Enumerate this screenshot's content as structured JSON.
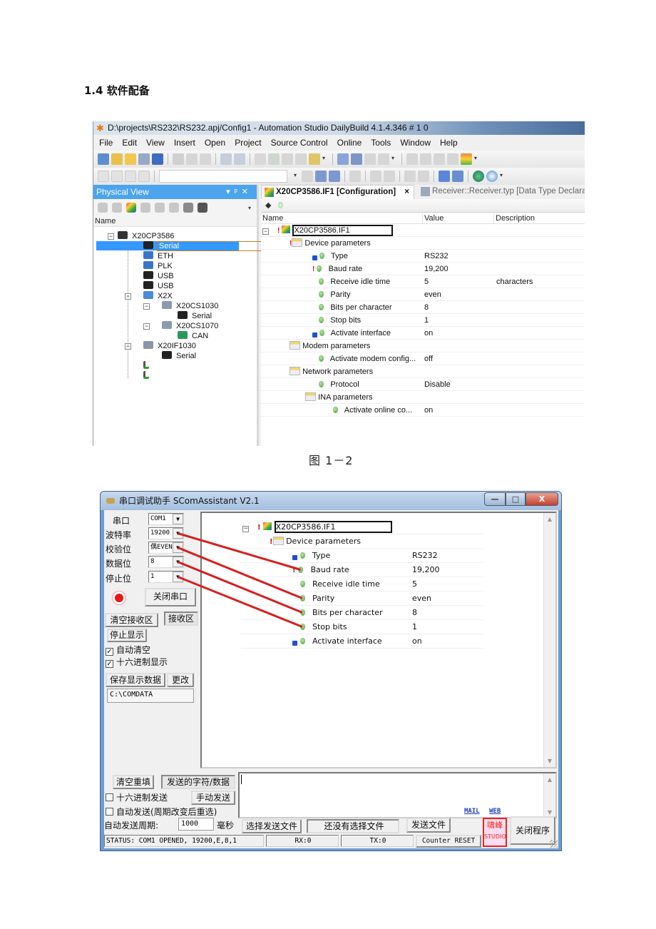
{
  "document": {
    "heading": "1.4 软件配备",
    "figure_caption": "图 1－2"
  },
  "automation_studio": {
    "title": "D:\\projects\\RS232\\RS232.apj/Config1 - Automation Studio DailyBuild 4.1.4.346 # 1 0",
    "menu": [
      "File",
      "Edit",
      "View",
      "Insert",
      "Open",
      "Project",
      "Source Control",
      "Online",
      "Tools",
      "Window",
      "Help"
    ],
    "physical_view": {
      "title": "Physical View",
      "column_header": "Name",
      "tree": [
        {
          "label": "X20CP3586",
          "icon": "cpu-icon",
          "level": 0
        },
        {
          "label": "Serial",
          "icon": "serial-port-icon",
          "level": 1,
          "selected": true
        },
        {
          "label": "ETH",
          "icon": "ethernet-icon",
          "level": 1
        },
        {
          "label": "PLK",
          "icon": "powerlink-icon",
          "level": 1
        },
        {
          "label": "USB",
          "icon": "usb-icon",
          "level": 1
        },
        {
          "label": "USB",
          "icon": "usb-icon",
          "level": 1
        },
        {
          "label": "X2X",
          "icon": "x2x-bus-icon",
          "level": 1
        },
        {
          "label": "X20CS1030",
          "icon": "module-icon",
          "level": 2
        },
        {
          "label": "Serial",
          "icon": "serial-port-icon",
          "level": 3
        },
        {
          "label": "X20CS1070",
          "icon": "module-icon",
          "level": 2
        },
        {
          "label": "CAN",
          "icon": "can-icon",
          "level": 3
        },
        {
          "label": "X20IF1030",
          "icon": "interface-module-icon",
          "level": 1
        },
        {
          "label": "Serial",
          "icon": "serial-port-icon",
          "level": 2
        },
        {
          "label": "",
          "icon": "add-slot-icon",
          "level": 1
        },
        {
          "label": "",
          "icon": "add-slot-icon",
          "level": 1
        }
      ]
    },
    "tabs": [
      {
        "label": "X20CP3586.IF1 [Configuration]",
        "active": true,
        "close": "×"
      },
      {
        "label": "Receiver::Receiver.typ [Data Type Declaratio",
        "active": false
      }
    ],
    "config_grid": {
      "columns": [
        "Name",
        "Value",
        "Description"
      ],
      "rows": [
        {
          "name": "X20CP3586.IF1",
          "value": "",
          "description": "",
          "kind": "root"
        },
        {
          "name": "Device parameters",
          "value": "",
          "description": "",
          "kind": "group"
        },
        {
          "name": "Type",
          "value": "RS232",
          "description": "",
          "kind": "param",
          "locked": true
        },
        {
          "name": "Baud rate",
          "value": "19,200",
          "description": "",
          "kind": "param",
          "changed": true
        },
        {
          "name": "Receive idle time",
          "value": "5",
          "description": "characters",
          "kind": "param"
        },
        {
          "name": "Parity",
          "value": "even",
          "description": "",
          "kind": "param"
        },
        {
          "name": "Bits per character",
          "value": "8",
          "description": "",
          "kind": "param"
        },
        {
          "name": "Stop bits",
          "value": "1",
          "description": "",
          "kind": "param"
        },
        {
          "name": "Activate interface",
          "value": "on",
          "description": "",
          "kind": "param",
          "locked": true
        },
        {
          "name": "Modem parameters",
          "value": "",
          "description": "",
          "kind": "group"
        },
        {
          "name": "Activate modem config...",
          "value": "off",
          "description": "",
          "kind": "param"
        },
        {
          "name": "Network parameters",
          "value": "",
          "description": "",
          "kind": "group"
        },
        {
          "name": "Protocol",
          "value": "Disable",
          "description": "",
          "kind": "param"
        },
        {
          "name": "INA parameters",
          "value": "",
          "description": "",
          "kind": "group"
        },
        {
          "name": "Activate online co...",
          "value": "on",
          "description": "",
          "kind": "param"
        }
      ]
    }
  },
  "scom": {
    "title": "串口调试助手 SComAssistant V2.1",
    "window_buttons": {
      "minimize": "—",
      "maximize": "□",
      "close": "X"
    },
    "settings": [
      {
        "label": "串口",
        "value": "COM1"
      },
      {
        "label": "波特率",
        "value": "19200"
      },
      {
        "label": "校验位",
        "value": "偶EVEN"
      },
      {
        "label": "数据位",
        "value": "8"
      },
      {
        "label": "停止位",
        "value": "1"
      }
    ],
    "port_status_color": "#e81818",
    "close_port_button": "关闭串口",
    "clear_receive_button": "清空接收区",
    "receive_area_label": "接收区",
    "stop_display_button": "停止显示",
    "auto_clear": {
      "label": "自动清空",
      "checked": true
    },
    "hex_display": {
      "label": "十六进制显示",
      "checked": true
    },
    "save_data_button": "保存显示数据",
    "change_button": "更改",
    "save_path": "C:\\COMDATA",
    "receive_grid": [
      {
        "name": "X20CP3586.IF1",
        "value": "",
        "kind": "root"
      },
      {
        "name": "Device parameters",
        "value": "",
        "kind": "group"
      },
      {
        "name": "Type",
        "value": "RS232",
        "kind": "param",
        "locked": true
      },
      {
        "name": "Baud rate",
        "value": "19,200",
        "kind": "param",
        "changed": true
      },
      {
        "name": "Receive idle time",
        "value": "5",
        "kind": "param"
      },
      {
        "name": "Parity",
        "value": "even",
        "kind": "param"
      },
      {
        "name": "Bits per character",
        "value": "8",
        "kind": "param"
      },
      {
        "name": "Stop bits",
        "value": "1",
        "kind": "param"
      },
      {
        "name": "Activate interface",
        "value": "on",
        "kind": "param",
        "locked": true
      }
    ],
    "annotation_arrows": [
      {
        "from": "波特率",
        "to": "Baud rate"
      },
      {
        "from": "校验位",
        "to": "Parity"
      },
      {
        "from": "数据位",
        "to": "Bits per character"
      },
      {
        "from": "停止位",
        "to": "Stop bits"
      }
    ],
    "annotation_color": "#d42020",
    "clear_refill_button": "清空重填",
    "send_chars_label": "发送的字符/数据",
    "hex_send": {
      "label": "十六进制发送",
      "checked": false
    },
    "manual_send_button": "手动发送",
    "auto_send": {
      "label": "自动发送(周期改变后重选)",
      "checked": false
    },
    "auto_send_period_label": "自动发送周期:",
    "auto_send_period_value": "1000",
    "auto_send_period_unit": "毫秒",
    "select_file_button": "选择发送文件",
    "no_file_label": "还没有选择文件",
    "send_file_button": "发送文件",
    "mail_link": "MAIL",
    "web_link": "WEB",
    "studio_stamp": {
      "line1": "啸峰",
      "line2": "STUDIO"
    },
    "close_program_button": "关闭程序",
    "status": {
      "text": "STATUS: COM1 OPENED, 19200,E,8,1",
      "rx": "RX:0",
      "tx": "TX:0",
      "counter_reset": "Counter RESET"
    }
  }
}
